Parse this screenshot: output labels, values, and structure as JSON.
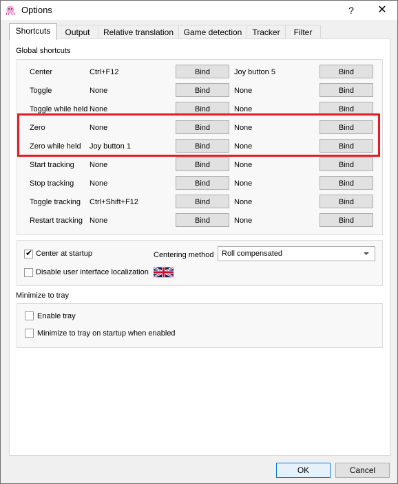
{
  "window": {
    "title": "Options",
    "help": "?",
    "close": "✕"
  },
  "tabs": [
    {
      "label": "Shortcuts"
    },
    {
      "label": "Output"
    },
    {
      "label": "Relative translation"
    },
    {
      "label": "Game detection"
    },
    {
      "label": "Tracker"
    },
    {
      "label": "Filter"
    }
  ],
  "global_shortcuts": {
    "title": "Global shortcuts",
    "rows": [
      {
        "name": "Center",
        "key1": "Ctrl+F12",
        "bind1": "Bind",
        "key2": "Joy button 5",
        "bind2": "Bind"
      },
      {
        "name": "Toggle",
        "key1": "None",
        "bind1": "Bind",
        "key2": "None",
        "bind2": "Bind"
      },
      {
        "name": "Toggle while held",
        "key1": "None",
        "bind1": "Bind",
        "key2": "None",
        "bind2": "Bind"
      },
      {
        "name": "Zero",
        "key1": "None",
        "bind1": "Bind",
        "key2": "None",
        "bind2": "Bind"
      },
      {
        "name": "Zero while held",
        "key1": "Joy button 1",
        "bind1": "Bind",
        "key2": "None",
        "bind2": "Bind"
      },
      {
        "name": "Start tracking",
        "key1": "None",
        "bind1": "Bind",
        "key2": "None",
        "bind2": "Bind"
      },
      {
        "name": "Stop tracking",
        "key1": "None",
        "bind1": "Bind",
        "key2": "None",
        "bind2": "Bind"
      },
      {
        "name": "Toggle tracking",
        "key1": "Ctrl+Shift+F12",
        "bind1": "Bind",
        "key2": "None",
        "bind2": "Bind"
      },
      {
        "name": "Restart tracking",
        "key1": "None",
        "bind1": "Bind",
        "key2": "None",
        "bind2": "Bind"
      }
    ]
  },
  "options": {
    "center_at_startup": {
      "label": "Center at startup",
      "checked": true
    },
    "centering_method": {
      "label": "Centering method",
      "value": "Roll compensated"
    },
    "disable_localization": {
      "label": "Disable user interface localization",
      "checked": false
    }
  },
  "tray": {
    "title": "Minimize to tray",
    "enable_tray": {
      "label": "Enable tray",
      "checked": false
    },
    "minimize_on_startup": {
      "label": "Minimize to tray on startup when enabled",
      "checked": false
    }
  },
  "footer": {
    "ok": "OK",
    "cancel": "Cancel"
  },
  "colors": {
    "highlight": "#e31b23",
    "button": "#e1e1e1",
    "ok_border": "#0078d7"
  },
  "icons": {
    "app": "pink-octopus-icon",
    "flag": "uk-flag-icon"
  }
}
